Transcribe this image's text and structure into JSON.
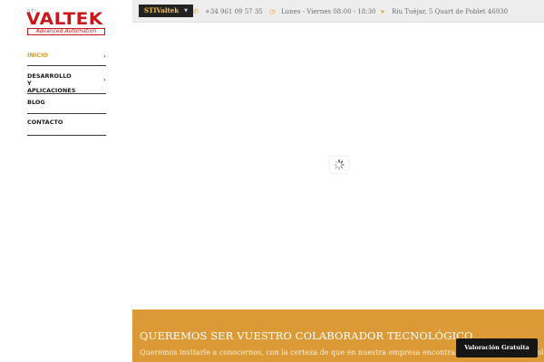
{
  "logo": {
    "prefix": "STI",
    "brand": "VALTEK",
    "tagline": "Advanced Automation"
  },
  "menu": [
    {
      "label": "INICIO",
      "active": true,
      "has_submenu": true
    },
    {
      "label": "DESARROLLO Y APLICACIONES",
      "active": false,
      "has_submenu": true
    },
    {
      "label": "BLOG",
      "active": false,
      "has_submenu": false
    },
    {
      "label": "CONTACTO",
      "active": false,
      "has_submenu": false
    }
  ],
  "topbar": {
    "sti_button": "STIValtek",
    "phone": "+34 961 09 57 35",
    "hours": "Lunes - Viernes 08:00 - 18:30",
    "address": "Riu Tuéjar, 5 Quart de Poblet 46930",
    "icons": {
      "phone": "phone-icon",
      "hours": "clock-icon",
      "address": "location-arrow-icon"
    }
  },
  "banner": {
    "title": "QUEREMOS SER VUESTRO COLABORADOR TECNOLÓGICO",
    "text": "Queremos invitarle a conocernos, con la certeza de que en nuestra empresa encontrará el colaborador tecnológico que estaba buscando."
  },
  "valoracion_button": "Valoración Gratuita",
  "colors": {
    "accent": "#e09a1e",
    "brand_red": "#c8181e",
    "banner_bg": "#dc9a36",
    "topbar_bg": "#ededed",
    "dark": "#232323"
  }
}
